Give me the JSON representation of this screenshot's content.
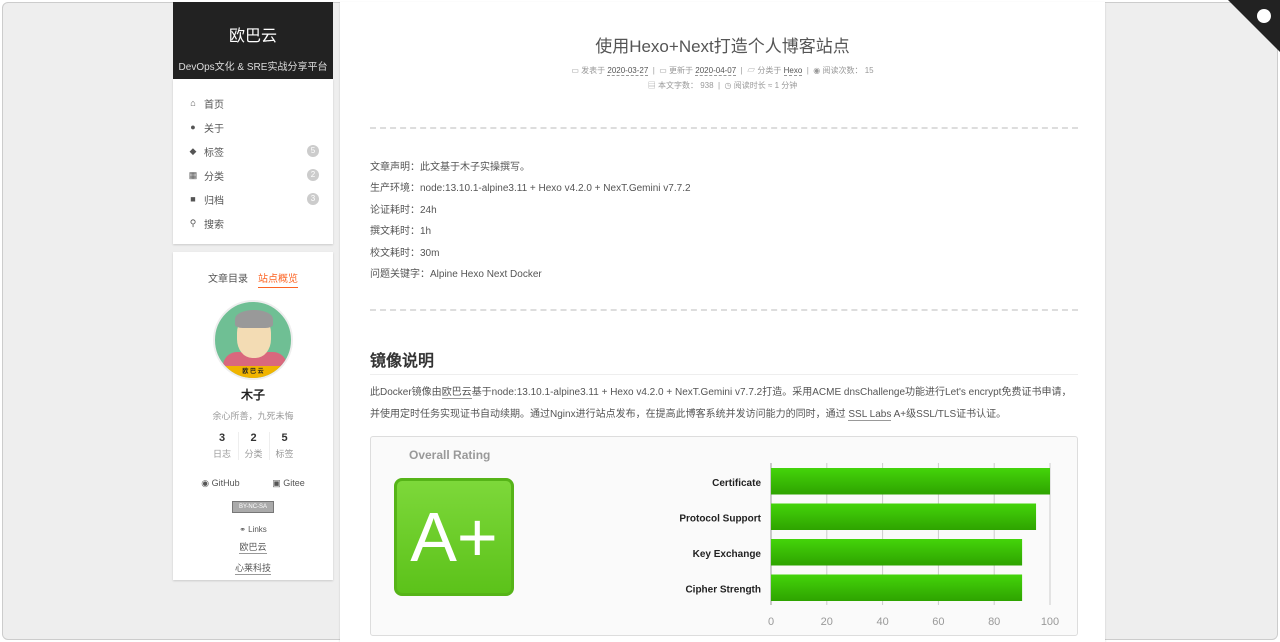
{
  "site": {
    "title": "欧巴云",
    "subtitle": "DevOps文化 & SRE实战分享平台"
  },
  "menu": [
    {
      "label": "首页",
      "icon": "home-icon"
    },
    {
      "label": "关于",
      "icon": "user-icon"
    },
    {
      "label": "标签",
      "icon": "tags-icon",
      "badge": "5"
    },
    {
      "label": "分类",
      "icon": "th-icon",
      "badge": "2"
    },
    {
      "label": "归档",
      "icon": "archive-icon",
      "badge": "3"
    },
    {
      "label": "搜索",
      "icon": "search-icon"
    }
  ],
  "sidebar": {
    "tab_toc": "文章目录",
    "tab_overview": "站点概览",
    "avatar_band": "欧 巴 云",
    "author": "木子",
    "motto": "余心所善，九死未悔",
    "stats": [
      {
        "n": "3",
        "l": "日志"
      },
      {
        "n": "2",
        "l": "分类"
      },
      {
        "n": "5",
        "l": "标签"
      }
    ],
    "github": "GitHub",
    "gitee": "Gitee",
    "license": "BY-NC-SA",
    "links_title": "Links",
    "links": [
      "欧巴云",
      "心莱科技"
    ]
  },
  "post": {
    "title": "使用Hexo+Next打造个人博客站点",
    "posted_label": "发表于",
    "posted": "2020-03-27",
    "updated_label": "更新于",
    "updated": "2020-04-07",
    "cat_label": "分类于",
    "category": "Hexo",
    "views_label": "阅读次数：",
    "views": "15",
    "words_label": "本文字数：",
    "words": "938",
    "read_label": "阅读时长 ≈",
    "read": "1 分钟",
    "decl": [
      "文章声明：此文基于木子实操撰写。",
      "生产环境：node:13.10.1-alpine3.11 + Hexo v4.2.0 + NexT.Gemini v7.7.2",
      "论证耗时：24h",
      "撰文耗时：1h",
      "校文耗时：30m",
      "问题关键字：Alpine Hexo Next Docker"
    ],
    "h2": "镜像说明",
    "p1a": "此Docker镜像由",
    "p1link": "欧巴云",
    "p1b": "基于node:13.10.1-alpine3.11 + Hexo v4.2.0 + NexT.Gemini v7.7.2打造。采用ACME dnsChallenge功能进行Let's encrypt免费证书申请，并使用定时任务实现证书自动续期。通过Nginx进行站点发布，在提高此博客系统并发访问能力的同时，通过 ",
    "p1link2": "SSL Labs",
    "p1c": " A+级SSL/TLS证书认证。"
  },
  "chart_data": {
    "type": "bar",
    "title": "Overall Rating",
    "grade": "A+",
    "categories": [
      "Certificate",
      "Protocol Support",
      "Key Exchange",
      "Cipher Strength"
    ],
    "values": [
      100,
      95,
      90,
      90
    ],
    "xlim": [
      0,
      100
    ],
    "xticks": [
      0,
      20,
      40,
      60,
      80,
      100
    ],
    "bar_color": "#3ac205"
  }
}
